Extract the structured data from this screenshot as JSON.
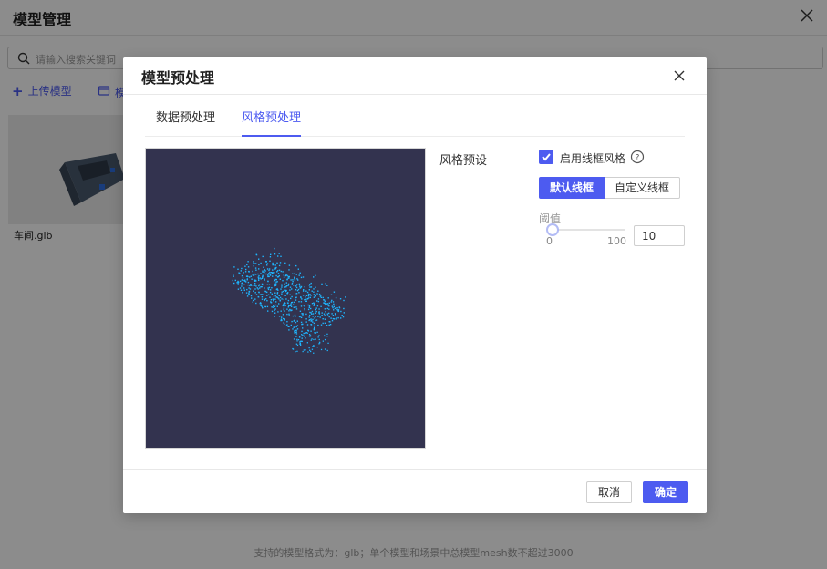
{
  "page": {
    "title": "模型管理",
    "search_placeholder": "请输入搜索关键词",
    "upload_label": "上传模型",
    "store_label": "模",
    "card_name": "车间.glb",
    "footnote": "支持的模型格式为：glb；单个模型和场景中总模型mesh数不超过3000"
  },
  "dialog": {
    "title": "模型预处理",
    "tabs": [
      {
        "label": "数据预处理",
        "active": false
      },
      {
        "label": "风格预处理",
        "active": true
      }
    ],
    "settings_label": "风格预设",
    "wireframe_checkbox_label": "启用线框风格",
    "wireframe_enabled": true,
    "segment": [
      {
        "label": "默认线框",
        "active": true
      },
      {
        "label": "自定义线框",
        "active": false
      }
    ],
    "threshold_label": "阈值",
    "slider_min": "0",
    "slider_max": "100",
    "slider_value": 10,
    "threshold_value": "10",
    "cancel_label": "取消",
    "ok_label": "确定"
  },
  "colors": {
    "accent": "#4d5bf0",
    "preview_bg": "#33334f",
    "wire": "#1fb6ff"
  },
  "icons": [
    "close-icon",
    "search-icon",
    "plus-icon",
    "store-icon",
    "checkbox-checked-icon",
    "help-circle-icon"
  ]
}
